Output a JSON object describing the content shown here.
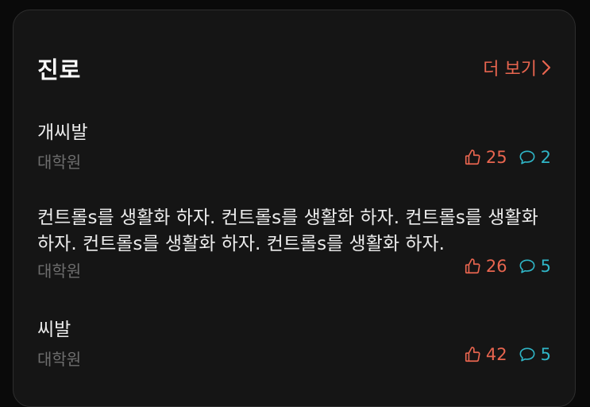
{
  "section": {
    "title": "진로",
    "more_label": "더 보기"
  },
  "posts": [
    {
      "title": "개씨발",
      "category": "대학원",
      "likes": "25",
      "comments": "2"
    },
    {
      "title": "컨트롤s를 생활화 하자. 컨트롤s를 생활화 하자. 컨트롤s를 생활화 하자. 컨트롤s를 생활화 하자. 컨트롤s를 생활화 하자.",
      "category": "대학원",
      "likes": "26",
      "comments": "5"
    },
    {
      "title": "씨발",
      "category": "대학원",
      "likes": "42",
      "comments": "5"
    }
  ],
  "colors": {
    "accent": "#e8654f",
    "comment": "#2fb5c6",
    "muted": "#6e6e6e"
  }
}
